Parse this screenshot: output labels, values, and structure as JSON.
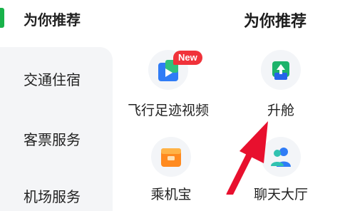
{
  "sidebar": {
    "active_label": "为你推荐",
    "items": [
      {
        "label": "交通住宿"
      },
      {
        "label": "客票服务"
      },
      {
        "label": "机场服务"
      }
    ]
  },
  "main": {
    "section_title": "为你推荐",
    "items": [
      {
        "label": "飞行足迹视频",
        "icon": "video-play-icon",
        "badge": "New"
      },
      {
        "label": "升舱",
        "icon": "upgrade-icon"
      },
      {
        "label": "乘机宝",
        "icon": "wallet-icon"
      },
      {
        "label": "聊天大厅",
        "icon": "chat-users-icon"
      }
    ]
  },
  "colors": {
    "accent_green": "#18b24a",
    "badge_red": "#f0323a",
    "arrow_red": "#e8102e",
    "sidebar_bg": "#f4f5f7"
  }
}
